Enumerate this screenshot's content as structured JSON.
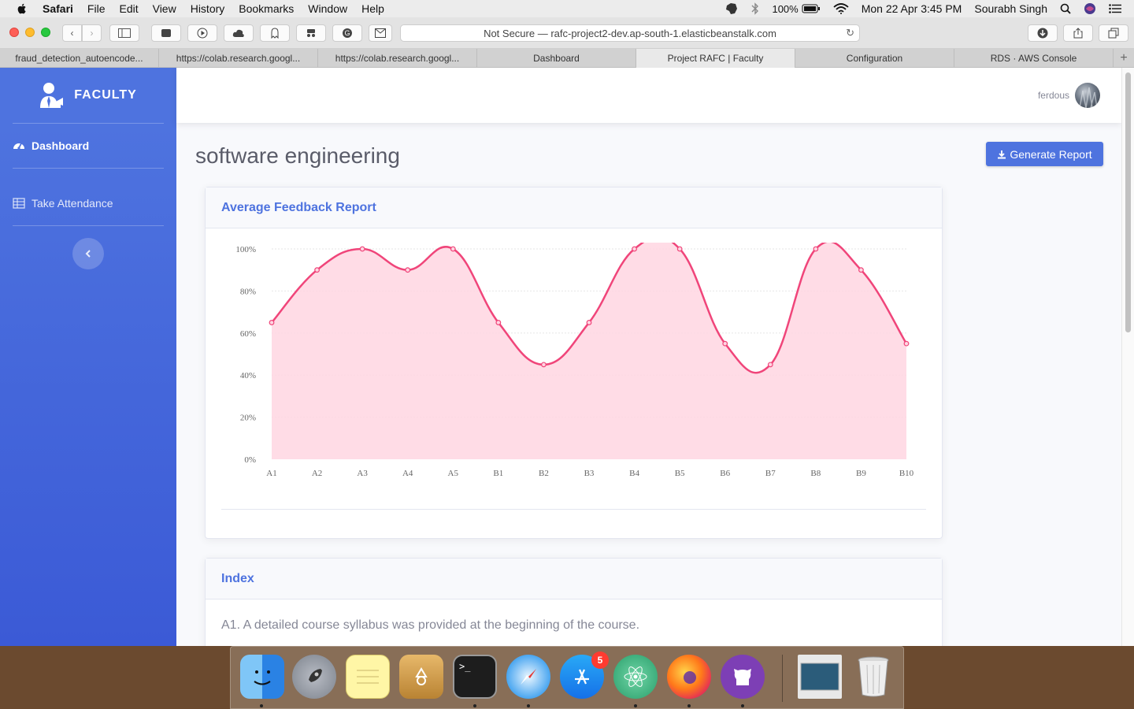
{
  "menubar": {
    "app_name": "Safari",
    "items": [
      "File",
      "Edit",
      "View",
      "History",
      "Bookmarks",
      "Window",
      "Help"
    ],
    "battery": "100%",
    "clock": "Mon 22 Apr  3:45 PM",
    "user": "Sourabh Singh"
  },
  "browser": {
    "url": "Not Secure — rafc-project2-dev.ap-south-1.elasticbeanstalk.com",
    "tabs": [
      {
        "label": "fraud_detection_autoencode..."
      },
      {
        "label": "https://colab.research.googl..."
      },
      {
        "label": "https://colab.research.googl..."
      },
      {
        "label": "Dashboard"
      },
      {
        "label": "Project RAFC | Faculty"
      },
      {
        "label": "Configuration"
      },
      {
        "label": "RDS · AWS Console"
      }
    ],
    "active_tab_index": 4
  },
  "sidebar": {
    "brand": "FACULTY",
    "items": [
      {
        "label": "Dashboard",
        "icon": "dashboard-icon"
      },
      {
        "label": "Take Attendance",
        "icon": "table-icon"
      }
    ]
  },
  "topbar": {
    "user_name": "ferdous"
  },
  "page": {
    "title": "software engineering",
    "generate_button": "Generate Report"
  },
  "feedback_card": {
    "header": "Average Feedback Report"
  },
  "index_card": {
    "header": "Index",
    "items": [
      "A1. A detailed course syllabus was provided at the beginning of the course."
    ]
  },
  "chart_data": {
    "type": "area",
    "title": "",
    "xlabel": "",
    "ylabel": "",
    "categories": [
      "A1",
      "A2",
      "A3",
      "A4",
      "A5",
      "B1",
      "B2",
      "B3",
      "B4",
      "B5",
      "B6",
      "B7",
      "B8",
      "B9",
      "B10"
    ],
    "series": [
      {
        "values": [
          65,
          90,
          100,
          90,
          100,
          65,
          45,
          65,
          100,
          100,
          55,
          45,
          100,
          90,
          55
        ]
      }
    ],
    "ylim": [
      0,
      100
    ],
    "yticks": [
      "0%",
      "20%",
      "40%",
      "60%",
      "80%",
      "100%"
    ],
    "grid": true,
    "legend": "none",
    "colors": {
      "line": "#f0457a",
      "fill": "#ffd6e2"
    }
  },
  "dock": {
    "apps": [
      {
        "name": "finder-icon"
      },
      {
        "name": "launchpad-icon"
      },
      {
        "name": "notes-icon"
      },
      {
        "name": "archive-utility-icon"
      },
      {
        "name": "terminal-icon"
      },
      {
        "name": "safari-icon"
      },
      {
        "name": "app-store-icon",
        "badge": "5"
      },
      {
        "name": "atom-icon"
      },
      {
        "name": "firefox-icon"
      },
      {
        "name": "github-desktop-icon"
      },
      {
        "name": "screenshot-thumbnail-icon"
      },
      {
        "name": "trash-icon"
      }
    ]
  }
}
